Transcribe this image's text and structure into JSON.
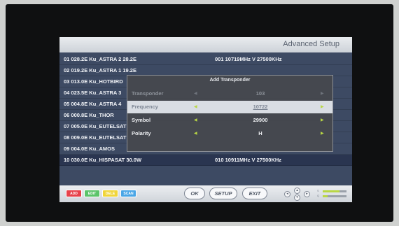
{
  "header": {
    "title": "Advanced Setup"
  },
  "satellites": [
    {
      "name": "01 028.2E Ku_ASTRA 2 28.2E",
      "transponder": "001 10719MHz V 27500KHz"
    },
    {
      "name": "02 019.2E Ku_ASTRA 1 19.2E",
      "transponder": ""
    },
    {
      "name": "03 013.0E Ku_HOTBIRD",
      "transponder": ""
    },
    {
      "name": "04 023.5E Ku_ASTRA 3",
      "transponder": ""
    },
    {
      "name": "05 004.8E Ku_ASTRA 4",
      "transponder": ""
    },
    {
      "name": "06 000.8E Ku_THOR",
      "transponder": ""
    },
    {
      "name": "07 005.0E Ku_EUTELSAT",
      "transponder": ""
    },
    {
      "name": "08 009.0E Ku_EUTELSAT",
      "transponder": ""
    },
    {
      "name": "09 004.0E Ku_AMOS",
      "transponder": ""
    },
    {
      "name": "10 030.0E Ku_HISPASAT 30.0W",
      "transponder": "010 10911MHz V 27500KHz"
    }
  ],
  "dialog": {
    "title": "Add Transponder",
    "fields": [
      {
        "label": "Transponder",
        "value": "103",
        "state": "disabled"
      },
      {
        "label": "Frequency",
        "value": "10722",
        "state": "active"
      },
      {
        "label": "Symbol",
        "value": "29900",
        "state": "normal"
      },
      {
        "label": "Polarity",
        "value": "H",
        "state": "normal"
      }
    ]
  },
  "footer": {
    "color_keys": [
      {
        "label": "ADD",
        "color": "#e7424a"
      },
      {
        "label": "EDIT",
        "color": "#5cc46a"
      },
      {
        "label": "DELE",
        "color": "#f0d53a"
      },
      {
        "label": "SCAN",
        "color": "#4aa6e6"
      }
    ],
    "ok_label": "OK",
    "setup_label": "SETUP",
    "exit_label": "EXIT",
    "signal": {
      "strength": 0.7,
      "quality": 0.2
    }
  },
  "colors": {
    "accent": "#b9d744",
    "panel": "#3d4a63"
  }
}
